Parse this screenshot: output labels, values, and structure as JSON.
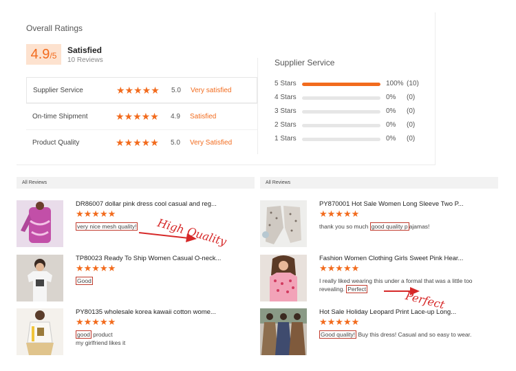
{
  "ratings": {
    "title": "Overall Ratings",
    "score": "4.9",
    "score_suffix": "/5",
    "satisfied_label": "Satisfied",
    "reviews_count": "10 Reviews",
    "metrics": [
      {
        "label": "Supplier Service",
        "stars": "★★★★★",
        "score": "5.0",
        "desc": "Very satisfied"
      },
      {
        "label": "On-time Shipment",
        "stars": "★★★★★",
        "score": "4.9",
        "desc": "Satisfied"
      },
      {
        "label": "Product Quality",
        "stars": "★★★★★",
        "score": "5.0",
        "desc": "Very Satisfied"
      }
    ]
  },
  "service": {
    "title": "Supplier Service",
    "rows": [
      {
        "label": "5  Stars",
        "fraction": 1.0,
        "pct": "100%",
        "count": "(10)"
      },
      {
        "label": "4  Stars",
        "fraction": 0.0,
        "pct": "0%",
        "count": "(0)"
      },
      {
        "label": "3  Stars",
        "fraction": 0.0,
        "pct": "0%",
        "count": "(0)"
      },
      {
        "label": "2  Stars",
        "fraction": 0.0,
        "pct": "0%",
        "count": "(0)"
      },
      {
        "label": "1  Stars",
        "fraction": 0.0,
        "pct": "0%",
        "count": "(0)"
      }
    ]
  },
  "all_reviews_label": "All Reviews",
  "reviews_left": [
    {
      "title": "DR86007 dollar pink dress cool casual and reg...",
      "stars": "★★★★★",
      "highlight": "very nice mesh quality!",
      "text_after": "",
      "line2": ""
    },
    {
      "title": "TP80023 Ready To Ship Women Casual O-neck...",
      "stars": "★★★★★",
      "highlight": "Good",
      "text_after": "",
      "line2": ""
    },
    {
      "title": "PY80135 wholesale korea kawaii cotton wome...",
      "stars": "★★★★★",
      "highlight": "good",
      "text_after": " product",
      "line2": "my girlfriend likes it"
    }
  ],
  "reviews_right": [
    {
      "title": "PY870001 Hot Sale Women Long Sleeve Two P...",
      "stars": "★★★★★",
      "text_before": "thank you so much ",
      "highlight": "good quality p",
      "text_after": "ajamas!"
    },
    {
      "title": "Fashion Women Clothing Girls Sweet Pink Hear...",
      "stars": "★★★★★",
      "text_before": "I really liked wearing this under a formal that was a little too revealing. ",
      "highlight": "Perfect",
      "text_after": ""
    },
    {
      "title": "Hot Sale Holiday Leopard Print Lace-up Long...",
      "stars": "★★★★★",
      "text_before": "",
      "highlight": "Good quality!",
      "text_after": " Buy this dress! Casual and so easy to wear."
    }
  ],
  "annotations": {
    "high_quality": "High Quality",
    "perfect": "Perfect"
  },
  "colors": {
    "accent": "#f26b1d",
    "highlight_box": "#c0392b",
    "annotation": "#d62828"
  }
}
